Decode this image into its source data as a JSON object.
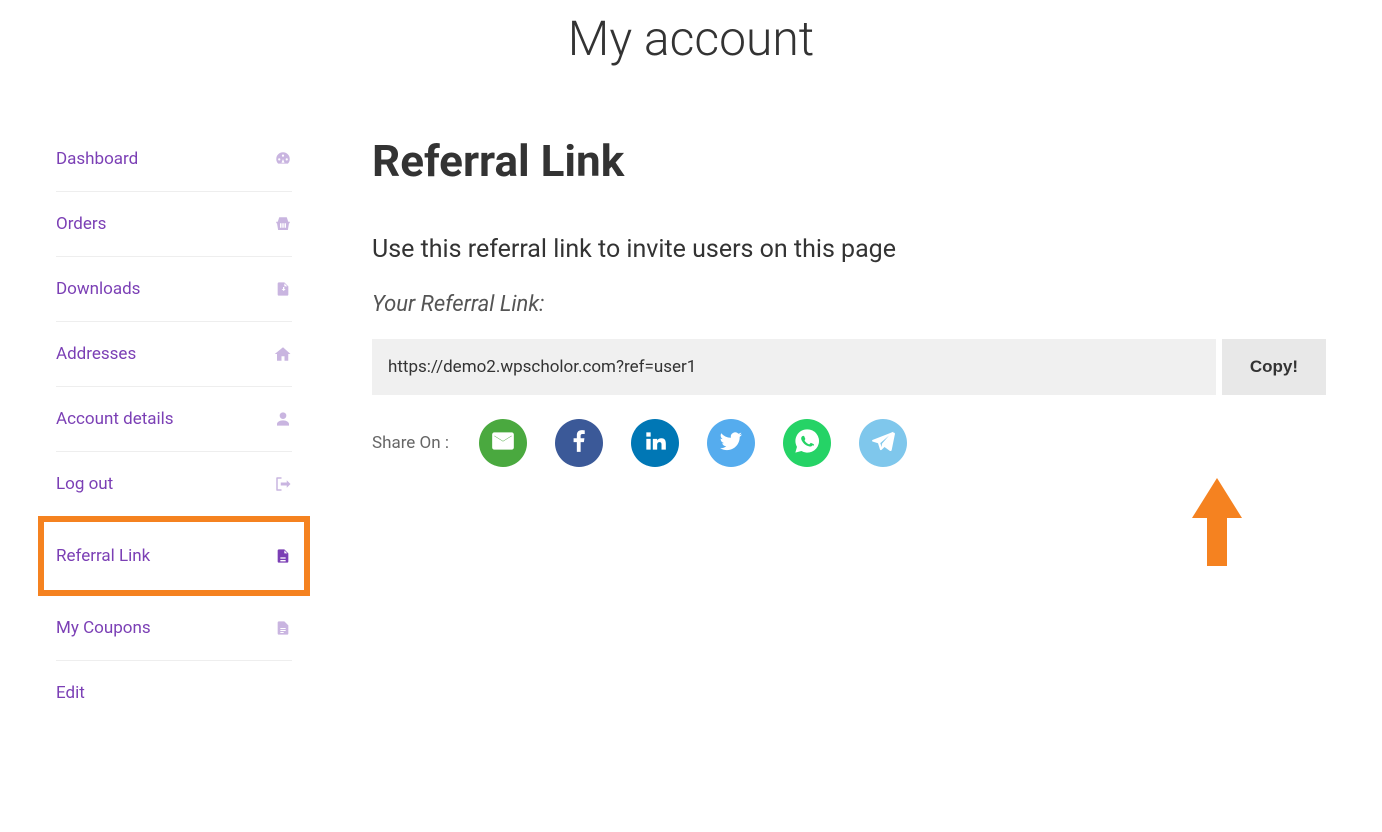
{
  "page_title": "My account",
  "sidebar": {
    "items": [
      {
        "label": "Dashboard",
        "icon": "gauge-icon"
      },
      {
        "label": "Orders",
        "icon": "basket-icon"
      },
      {
        "label": "Downloads",
        "icon": "file-download-icon"
      },
      {
        "label": "Addresses",
        "icon": "home-icon"
      },
      {
        "label": "Account details",
        "icon": "user-icon"
      },
      {
        "label": "Log out",
        "icon": "signout-icon"
      },
      {
        "label": "Referral Link",
        "icon": "document-icon",
        "active": true,
        "highlighted": true
      },
      {
        "label": "My Coupons",
        "icon": "coupon-icon"
      },
      {
        "label": "Edit",
        "icon": ""
      }
    ]
  },
  "main": {
    "heading": "Referral Link",
    "subheading": "Use this referral link to invite users on this page",
    "label": "Your Referral Link:",
    "link_value": "https://demo2.wpscholor.com?ref=user1",
    "copy_label": "Copy!",
    "share_label": "Share On :",
    "share_targets": [
      {
        "name": "email",
        "bg": "#4aa93f"
      },
      {
        "name": "facebook",
        "bg": "#3b5998"
      },
      {
        "name": "linkedin",
        "bg": "#0077b5"
      },
      {
        "name": "twitter",
        "bg": "#55acee"
      },
      {
        "name": "whatsapp",
        "bg": "#25d366"
      },
      {
        "name": "telegram",
        "bg": "#7fc7ec"
      }
    ]
  },
  "colors": {
    "accent_purple": "#7b3fb5",
    "highlight_orange": "#f58220"
  }
}
